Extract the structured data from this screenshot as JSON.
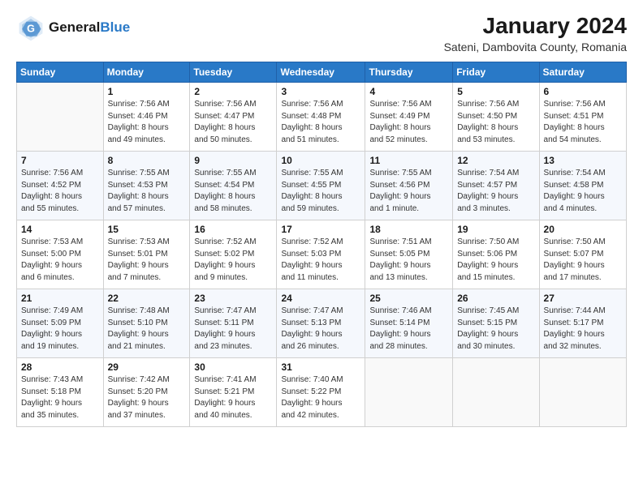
{
  "header": {
    "logo_general": "General",
    "logo_blue": "Blue",
    "month_title": "January 2024",
    "location": "Sateni, Dambovita County, Romania"
  },
  "days_of_week": [
    "Sunday",
    "Monday",
    "Tuesday",
    "Wednesday",
    "Thursday",
    "Friday",
    "Saturday"
  ],
  "weeks": [
    [
      {
        "day": "",
        "info": ""
      },
      {
        "day": "1",
        "info": "Sunrise: 7:56 AM\nSunset: 4:46 PM\nDaylight: 8 hours\nand 49 minutes."
      },
      {
        "day": "2",
        "info": "Sunrise: 7:56 AM\nSunset: 4:47 PM\nDaylight: 8 hours\nand 50 minutes."
      },
      {
        "day": "3",
        "info": "Sunrise: 7:56 AM\nSunset: 4:48 PM\nDaylight: 8 hours\nand 51 minutes."
      },
      {
        "day": "4",
        "info": "Sunrise: 7:56 AM\nSunset: 4:49 PM\nDaylight: 8 hours\nand 52 minutes."
      },
      {
        "day": "5",
        "info": "Sunrise: 7:56 AM\nSunset: 4:50 PM\nDaylight: 8 hours\nand 53 minutes."
      },
      {
        "day": "6",
        "info": "Sunrise: 7:56 AM\nSunset: 4:51 PM\nDaylight: 8 hours\nand 54 minutes."
      }
    ],
    [
      {
        "day": "7",
        "info": "Sunrise: 7:56 AM\nSunset: 4:52 PM\nDaylight: 8 hours\nand 55 minutes."
      },
      {
        "day": "8",
        "info": "Sunrise: 7:55 AM\nSunset: 4:53 PM\nDaylight: 8 hours\nand 57 minutes."
      },
      {
        "day": "9",
        "info": "Sunrise: 7:55 AM\nSunset: 4:54 PM\nDaylight: 8 hours\nand 58 minutes."
      },
      {
        "day": "10",
        "info": "Sunrise: 7:55 AM\nSunset: 4:55 PM\nDaylight: 8 hours\nand 59 minutes."
      },
      {
        "day": "11",
        "info": "Sunrise: 7:55 AM\nSunset: 4:56 PM\nDaylight: 9 hours\nand 1 minute."
      },
      {
        "day": "12",
        "info": "Sunrise: 7:54 AM\nSunset: 4:57 PM\nDaylight: 9 hours\nand 3 minutes."
      },
      {
        "day": "13",
        "info": "Sunrise: 7:54 AM\nSunset: 4:58 PM\nDaylight: 9 hours\nand 4 minutes."
      }
    ],
    [
      {
        "day": "14",
        "info": "Sunrise: 7:53 AM\nSunset: 5:00 PM\nDaylight: 9 hours\nand 6 minutes."
      },
      {
        "day": "15",
        "info": "Sunrise: 7:53 AM\nSunset: 5:01 PM\nDaylight: 9 hours\nand 7 minutes."
      },
      {
        "day": "16",
        "info": "Sunrise: 7:52 AM\nSunset: 5:02 PM\nDaylight: 9 hours\nand 9 minutes."
      },
      {
        "day": "17",
        "info": "Sunrise: 7:52 AM\nSunset: 5:03 PM\nDaylight: 9 hours\nand 11 minutes."
      },
      {
        "day": "18",
        "info": "Sunrise: 7:51 AM\nSunset: 5:05 PM\nDaylight: 9 hours\nand 13 minutes."
      },
      {
        "day": "19",
        "info": "Sunrise: 7:50 AM\nSunset: 5:06 PM\nDaylight: 9 hours\nand 15 minutes."
      },
      {
        "day": "20",
        "info": "Sunrise: 7:50 AM\nSunset: 5:07 PM\nDaylight: 9 hours\nand 17 minutes."
      }
    ],
    [
      {
        "day": "21",
        "info": "Sunrise: 7:49 AM\nSunset: 5:09 PM\nDaylight: 9 hours\nand 19 minutes."
      },
      {
        "day": "22",
        "info": "Sunrise: 7:48 AM\nSunset: 5:10 PM\nDaylight: 9 hours\nand 21 minutes."
      },
      {
        "day": "23",
        "info": "Sunrise: 7:47 AM\nSunset: 5:11 PM\nDaylight: 9 hours\nand 23 minutes."
      },
      {
        "day": "24",
        "info": "Sunrise: 7:47 AM\nSunset: 5:13 PM\nDaylight: 9 hours\nand 26 minutes."
      },
      {
        "day": "25",
        "info": "Sunrise: 7:46 AM\nSunset: 5:14 PM\nDaylight: 9 hours\nand 28 minutes."
      },
      {
        "day": "26",
        "info": "Sunrise: 7:45 AM\nSunset: 5:15 PM\nDaylight: 9 hours\nand 30 minutes."
      },
      {
        "day": "27",
        "info": "Sunrise: 7:44 AM\nSunset: 5:17 PM\nDaylight: 9 hours\nand 32 minutes."
      }
    ],
    [
      {
        "day": "28",
        "info": "Sunrise: 7:43 AM\nSunset: 5:18 PM\nDaylight: 9 hours\nand 35 minutes."
      },
      {
        "day": "29",
        "info": "Sunrise: 7:42 AM\nSunset: 5:20 PM\nDaylight: 9 hours\nand 37 minutes."
      },
      {
        "day": "30",
        "info": "Sunrise: 7:41 AM\nSunset: 5:21 PM\nDaylight: 9 hours\nand 40 minutes."
      },
      {
        "day": "31",
        "info": "Sunrise: 7:40 AM\nSunset: 5:22 PM\nDaylight: 9 hours\nand 42 minutes."
      },
      {
        "day": "",
        "info": ""
      },
      {
        "day": "",
        "info": ""
      },
      {
        "day": "",
        "info": ""
      }
    ]
  ]
}
